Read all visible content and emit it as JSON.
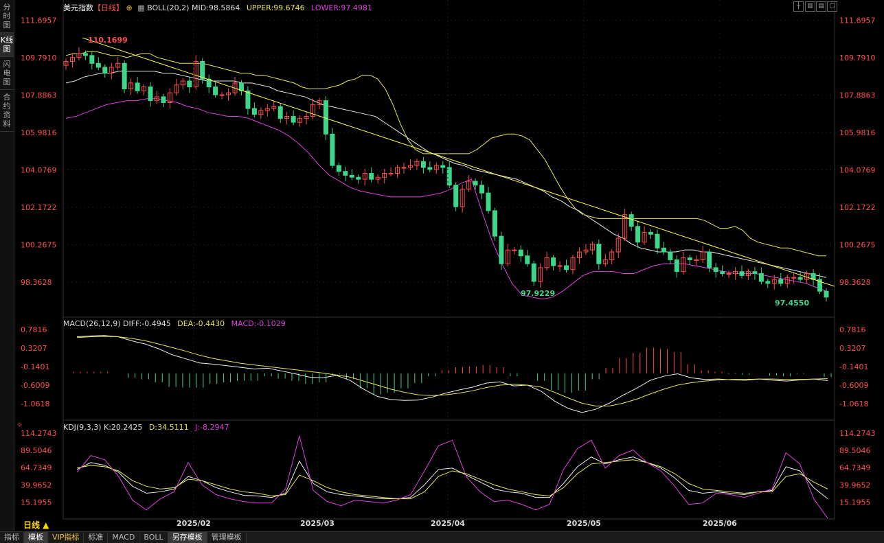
{
  "sidebar": {
    "tabs": [
      "分时图",
      "K线图",
      "闪电图",
      "合约资料"
    ],
    "active": 1
  },
  "main_header": {
    "title": "美元指数",
    "period": "【日线】",
    "indicator": "BOLL(20,2)",
    "mid": "MID:98.5864",
    "upper": "UPPER:99.6746",
    "lower": "LOWER:97.4981"
  },
  "macd_header": {
    "name": "MACD(26,12,9)",
    "diff": "DIFF:-0.4945",
    "dea": "DEA:-0.4430",
    "macd": "MACD:-0.1029"
  },
  "kdj_header": {
    "name": "KDJ(9,3,3)",
    "k": "K:20.2425",
    "d": "D:34.5111",
    "j": "J:-8.2947"
  },
  "annotations": {
    "high": "110.1699",
    "low1": "97.9229",
    "low2": "97.4550"
  },
  "period_button": "日线 ▲",
  "bottom_tabs": [
    "指标",
    "模板",
    "VIP指标",
    "标准",
    "MACD",
    "BOLL",
    "另存模板",
    "管理模板"
  ],
  "bottom_active": [
    1,
    6
  ],
  "colors": {
    "up": "#ff4d4d",
    "down": "#3ed68a",
    "upper_band": "#e8e850",
    "mid_band": "#e8e8e8",
    "lower_band": "#e040e0",
    "trendline": "#ffff40",
    "axis_text": "#ff4d4d"
  },
  "chart_data": [
    {
      "type": "candlestick",
      "title": "美元指数 日线",
      "y_ticks": [
        "111.6957",
        "109.7910",
        "107.8863",
        "105.9816",
        "104.0769",
        "102.1722",
        "100.2675",
        "98.3628"
      ],
      "ylim": [
        97.0,
        112.2
      ],
      "x_ticks": [
        "2025/02",
        "2025/03",
        "2025/04",
        "2025/05",
        "2025/06"
      ],
      "closes": [
        109.6,
        109.8,
        110.0,
        109.9,
        109.5,
        109.3,
        109.0,
        109.3,
        109.5,
        108.2,
        108.5,
        108.1,
        108.3,
        107.6,
        107.8,
        107.5,
        108.0,
        108.4,
        108.6,
        108.3,
        109.6,
        108.7,
        108.3,
        107.9,
        107.9,
        108.0,
        108.5,
        108.1,
        107.2,
        106.9,
        107.1,
        107.2,
        107.3,
        106.7,
        106.8,
        106.5,
        106.7,
        106.8,
        107.4,
        107.6,
        105.9,
        104.3,
        104.0,
        103.8,
        103.7,
        103.6,
        103.9,
        103.6,
        103.7,
        103.9,
        103.9,
        104.2,
        104.2,
        104.3,
        104.5,
        104.2,
        104.1,
        104.3,
        104.2,
        103.3,
        102.2,
        103.1,
        103.5,
        103.3,
        102.9,
        102.0,
        100.7,
        99.3,
        100.0,
        100.0,
        99.7,
        99.3,
        98.4,
        99.1,
        99.6,
        99.2,
        99.2,
        99.0,
        99.6,
        99.9,
        100.0,
        100.3,
        99.3,
        99.5,
        99.9,
        100.6,
        101.8,
        101.2,
        100.4,
        100.9,
        100.8,
        100.1,
        99.9,
        99.5,
        98.9,
        99.6,
        99.5,
        99.5,
        99.9,
        99.1,
        98.9,
        98.8,
        98.8,
        98.9,
        98.7,
        98.9,
        98.8,
        98.4,
        98.3,
        98.5,
        98.3,
        98.6,
        98.6,
        98.5,
        98.8,
        98.5,
        97.9,
        97.6
      ],
      "upper_band": [
        109.9,
        110.0,
        110.0,
        110.1,
        110.1,
        110.0,
        109.9,
        109.9,
        109.8,
        109.9,
        110.0,
        110.0,
        109.8,
        109.7,
        109.6,
        109.5,
        109.5,
        109.5,
        109.5,
        109.4,
        109.3,
        109.2,
        109.1,
        109.0,
        109.0,
        108.9,
        108.9,
        108.8,
        108.7,
        108.6,
        108.5,
        108.3,
        108.2,
        108.2,
        108.2,
        108.3,
        108.4,
        108.6,
        108.7,
        108.9,
        108.9,
        108.7,
        108.2,
        107.4,
        106.4,
        105.6,
        105.1,
        104.9,
        104.9,
        104.9,
        104.9,
        104.9,
        104.9,
        104.9,
        105.1,
        105.4,
        105.7,
        105.8,
        105.9,
        105.9,
        105.8,
        105.6,
        105.1,
        104.6,
        103.9,
        103.2,
        102.6,
        102.1,
        101.8,
        101.7,
        101.6,
        101.6,
        101.6,
        101.6,
        101.6,
        101.6,
        101.6,
        101.6,
        101.6,
        101.6,
        101.6,
        101.6,
        101.6,
        101.6,
        101.5,
        101.3,
        101.1,
        101.1,
        101.2,
        101.0,
        100.6,
        100.4,
        100.3,
        100.2,
        100.1,
        100.1,
        100.0,
        99.9,
        99.8,
        99.7,
        99.7
      ],
      "mid_band": [
        108.5,
        108.6,
        108.8,
        108.9,
        109.0,
        109.0,
        109.1,
        109.1,
        109.1,
        109.1,
        109.1,
        109.0,
        109.0,
        108.9,
        108.8,
        108.7,
        108.6,
        108.6,
        108.6,
        108.6,
        108.5,
        108.5,
        108.4,
        108.3,
        108.1,
        108.0,
        107.9,
        107.8,
        107.6,
        107.4,
        107.3,
        107.2,
        107.1,
        107.0,
        106.9,
        106.8,
        106.5,
        106.2,
        105.9,
        105.6,
        105.3,
        105.0,
        104.8,
        104.6,
        104.4,
        104.3,
        104.1,
        104.0,
        103.9,
        103.8,
        103.7,
        103.6,
        103.4,
        103.2,
        103.0,
        102.7,
        102.5,
        102.2,
        102.0,
        101.7,
        101.4,
        101.1,
        100.8,
        100.6,
        100.3,
        100.1,
        100.0,
        99.9,
        99.9,
        99.9,
        100.0,
        100.0,
        99.9,
        99.9,
        99.8,
        99.7,
        99.6,
        99.5,
        99.4,
        99.3,
        99.2,
        99.1,
        99.0,
        98.9,
        98.8,
        98.7,
        98.6
      ],
      "lower_band": [
        106.7,
        106.8,
        107.0,
        107.2,
        107.4,
        107.5,
        107.6,
        107.6,
        107.7,
        107.7,
        107.6,
        107.5,
        107.3,
        107.2,
        107.0,
        106.9,
        106.8,
        106.8,
        106.7,
        106.5,
        106.3,
        106.1,
        105.8,
        105.4,
        104.9,
        104.3,
        103.8,
        103.5,
        103.2,
        103.0,
        102.9,
        102.8,
        102.7,
        102.7,
        102.7,
        102.7,
        102.8,
        102.9,
        103.1,
        103.4,
        103.6,
        102.0,
        100.5,
        99.3,
        98.3,
        97.7,
        97.6,
        97.5,
        97.6,
        97.9,
        98.3,
        98.7,
        98.9,
        98.9,
        98.9,
        98.8,
        98.8,
        99.0,
        99.2,
        99.3,
        99.3,
        99.3,
        99.2,
        99.1,
        99.0,
        98.9,
        98.8,
        98.8,
        98.8,
        98.7,
        98.6,
        98.5,
        98.4,
        98.3,
        98.1,
        97.9
      ],
      "trendline_start": 110.8,
      "trendline_end": 98.15
    },
    {
      "type": "line",
      "title": "MACD(26,12,9)",
      "y_ticks": [
        "0.7816",
        "0.3207",
        "-0.1401",
        "-0.6009",
        "-1.0618"
      ],
      "ylim": [
        -1.35,
        0.95
      ],
      "series": [
        {
          "name": "DIFF",
          "values": [
            0.6,
            0.62,
            0.63,
            0.6,
            0.5,
            0.42,
            0.3,
            0.15,
            0.05,
            -0.05,
            -0.08,
            -0.12,
            -0.16,
            -0.2,
            -0.18,
            -0.25,
            -0.32,
            -0.4,
            -0.42,
            -0.36,
            -0.48,
            -0.7,
            -0.88,
            -0.96,
            -0.98,
            -0.97,
            -0.9,
            -0.8,
            -0.72,
            -0.65,
            -0.55,
            -0.52,
            -0.62,
            -0.6,
            -0.75,
            -1.0,
            -1.18,
            -1.28,
            -1.2,
            -1.05,
            -0.85,
            -0.68,
            -0.48,
            -0.38,
            -0.32,
            -0.42,
            -0.46,
            -0.45,
            -0.47,
            -0.48,
            -0.45,
            -0.48,
            -0.5,
            -0.47,
            -0.45,
            -0.49
          ]
        },
        {
          "name": "DEA",
          "values": [
            0.58,
            0.6,
            0.61,
            0.6,
            0.56,
            0.5,
            0.42,
            0.33,
            0.24,
            0.14,
            0.06,
            0.0,
            -0.06,
            -0.1,
            -0.14,
            -0.18,
            -0.22,
            -0.26,
            -0.3,
            -0.35,
            -0.4,
            -0.5,
            -0.6,
            -0.7,
            -0.78,
            -0.84,
            -0.86,
            -0.84,
            -0.8,
            -0.74,
            -0.66,
            -0.6,
            -0.58,
            -0.6,
            -0.65,
            -0.78,
            -0.92,
            -1.05,
            -1.12,
            -1.12,
            -1.05,
            -0.95,
            -0.82,
            -0.7,
            -0.6,
            -0.54,
            -0.5,
            -0.47,
            -0.46,
            -0.46,
            -0.45,
            -0.45,
            -0.46,
            -0.46,
            -0.45,
            -0.44
          ]
        }
      ],
      "histogram": [
        0.04,
        0.04,
        0.04,
        0.0,
        -0.12,
        -0.16,
        -0.24,
        -0.36,
        -0.38,
        -0.38,
        -0.28,
        -0.24,
        -0.2,
        -0.2,
        -0.08,
        -0.14,
        -0.2,
        -0.28,
        -0.24,
        -0.02,
        -0.16,
        -0.4,
        -0.56,
        -0.52,
        -0.4,
        -0.26,
        -0.08,
        0.08,
        0.16,
        0.18,
        0.22,
        0.16,
        -0.08,
        0.0,
        -0.2,
        -0.44,
        -0.52,
        -0.46,
        -0.16,
        0.14,
        0.4,
        0.54,
        0.68,
        0.64,
        0.56,
        0.24,
        0.08,
        0.04,
        -0.02,
        -0.04,
        0.0,
        -0.06,
        -0.08,
        -0.02,
        0.0,
        -0.1
      ]
    },
    {
      "type": "line",
      "title": "KDJ(9,3,3)",
      "y_ticks": [
        "114.2743",
        "89.5046",
        "64.7349",
        "39.9652",
        "15.1955"
      ],
      "ylim": [
        -5,
        120
      ],
      "series": [
        {
          "name": "K",
          "values": [
            62,
            72,
            68,
            58,
            38,
            28,
            30,
            34,
            52,
            46,
            36,
            30,
            25,
            24,
            22,
            28,
            74,
            42,
            30,
            26,
            24,
            22,
            20,
            20,
            22,
            40,
            62,
            64,
            54,
            44,
            34,
            30,
            28,
            22,
            22,
            42,
            66,
            80,
            70,
            76,
            80,
            72,
            64,
            50,
            32,
            28,
            30,
            28,
            26,
            30,
            32,
            66,
            60,
            36,
            20
          ]
        },
        {
          "name": "D",
          "values": [
            64,
            68,
            66,
            60,
            46,
            38,
            34,
            36,
            48,
            46,
            40,
            34,
            30,
            28,
            24,
            26,
            54,
            46,
            36,
            30,
            26,
            24,
            22,
            20,
            20,
            30,
            52,
            60,
            56,
            48,
            40,
            34,
            30,
            26,
            24,
            36,
            56,
            70,
            72,
            74,
            76,
            72,
            66,
            56,
            42,
            34,
            32,
            30,
            28,
            30,
            30,
            52,
            56,
            44,
            34
          ]
        },
        {
          "name": "J",
          "values": [
            58,
            82,
            76,
            52,
            18,
            4,
            20,
            30,
            72,
            40,
            26,
            20,
            16,
            14,
            14,
            34,
            110,
            32,
            16,
            10,
            18,
            16,
            14,
            18,
            26,
            60,
            96,
            104,
            52,
            30,
            16,
            18,
            12,
            4,
            12,
            62,
            92,
            104,
            64,
            82,
            90,
            72,
            60,
            38,
            12,
            14,
            28,
            26,
            22,
            28,
            34,
            86,
            70,
            20,
            -8
          ]
        }
      ]
    }
  ]
}
